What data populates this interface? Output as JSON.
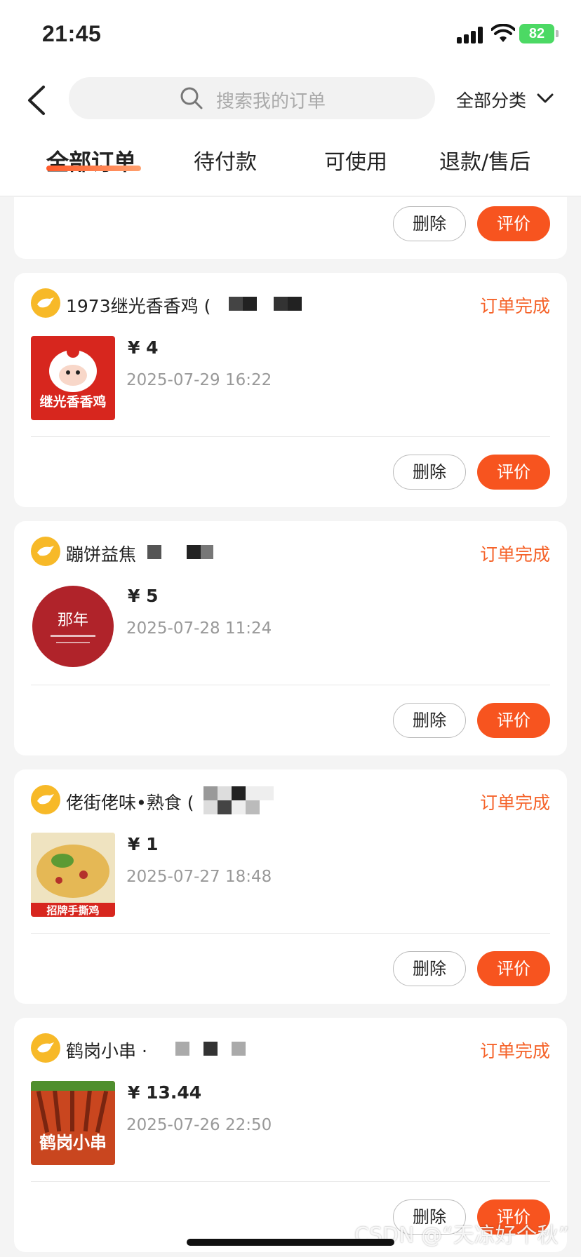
{
  "status_bar": {
    "time": "21:45",
    "battery": "82"
  },
  "header": {
    "search_placeholder": "搜索我的订单",
    "category": "全部分类",
    "tabs": [
      "全部订单",
      "待付款",
      "可使用",
      "退款/售后"
    ]
  },
  "buttons": {
    "delete": "删除",
    "rate": "评价"
  },
  "orders": [
    {
      "shop": "1973继光香香鸡 (",
      "status": "订单完成",
      "price": "¥ 4",
      "date": "2025-07-29 16:22",
      "thumb_text": "继光香香鸡"
    },
    {
      "shop": "蹦饼益焦",
      "status": "订单完成",
      "price": "¥ 5",
      "date": "2025-07-28 11:24",
      "thumb_text": "那年"
    },
    {
      "shop": "佬街佬味•熟食 (",
      "status": "订单完成",
      "price": "¥ 1",
      "date": "2025-07-27 18:48",
      "thumb_text": "招牌手撕鸡"
    },
    {
      "shop": "鹤岗小串 ·",
      "status": "订单完成",
      "price": "¥ 13.44",
      "date": "2025-07-26 22:50",
      "thumb_text": "鹤岗小串"
    }
  ],
  "watermark": "CSDN @“天凉好个秋”",
  "colors": {
    "accent": "#f7541f",
    "status": "#f5632a",
    "tab_underline": "#ff5a2a"
  }
}
